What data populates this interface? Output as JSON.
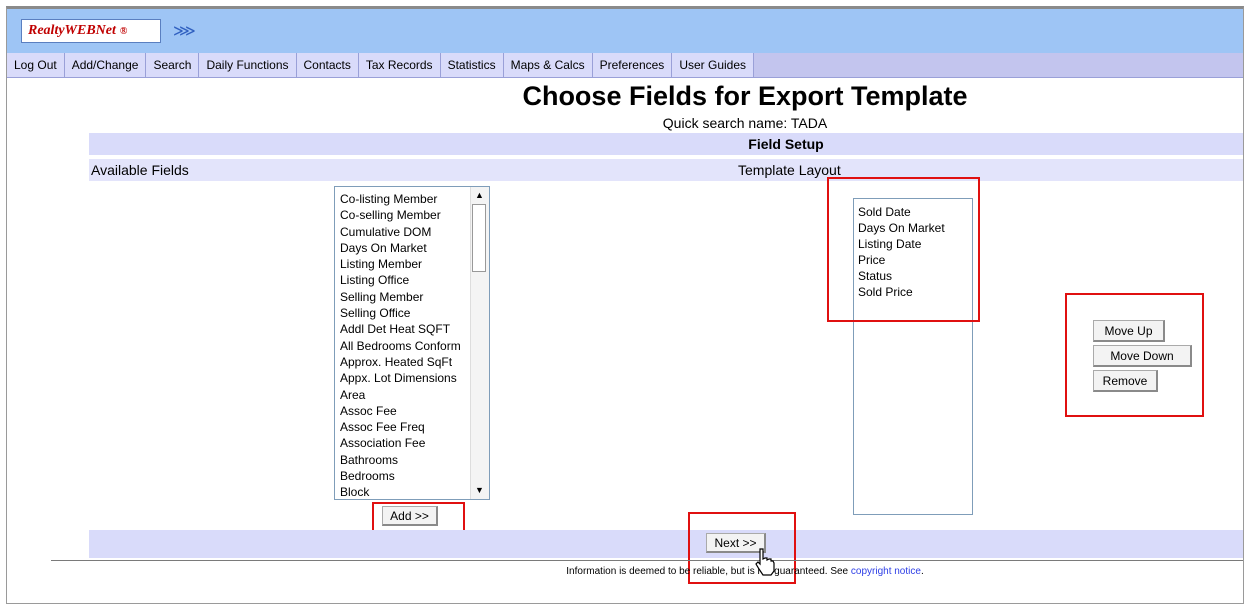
{
  "brand": {
    "logo_text": "RealtyWEBNet",
    "logo_mark": "®",
    "forward_icon": "⋙"
  },
  "nav": {
    "items": [
      "Log Out",
      "Add/Change",
      "Search",
      "Daily Functions",
      "Contacts",
      "Tax Records",
      "Statistics",
      "Maps & Calcs",
      "Preferences",
      "User Guides"
    ]
  },
  "page": {
    "title": "Choose Fields for Export Template",
    "subtitle": "Quick search name: TADA",
    "section_header": "Field Setup",
    "available_label": "Available Fields",
    "layout_label": "Template Layout"
  },
  "available_fields": [
    "Co-listing Member",
    "Co-selling Member",
    "Cumulative DOM",
    "Days On Market",
    "Listing Member",
    "Listing Office",
    "Selling Member",
    "Selling Office",
    "Addl Det Heat SQFT",
    "All Bedrooms Conform",
    "Approx. Heated SqFt",
    "Appx. Lot Dimensions",
    "Area",
    "Assoc Fee",
    "Assoc Fee Freq",
    "Association Fee",
    "Bathrooms",
    "Bedrooms",
    "Block"
  ],
  "template_fields": [
    "Sold Date",
    "Days On Market",
    "Listing Date",
    "Price",
    "Status",
    "Sold Price"
  ],
  "buttons": {
    "add": "Add >>",
    "move_up": "Move Up",
    "move_down": "Move Down",
    "remove": "Remove",
    "next": "Next >>"
  },
  "footer": {
    "text_before": "Information is deemed to be reliable, but is not guaranteed. See ",
    "link": "copyright notice",
    "text_after": "."
  },
  "colors": {
    "nav_bg": "#d9dbfa",
    "header_bg": "#9ec5f5",
    "highlight_box": "#e01010",
    "link": "#2d3ee6"
  }
}
